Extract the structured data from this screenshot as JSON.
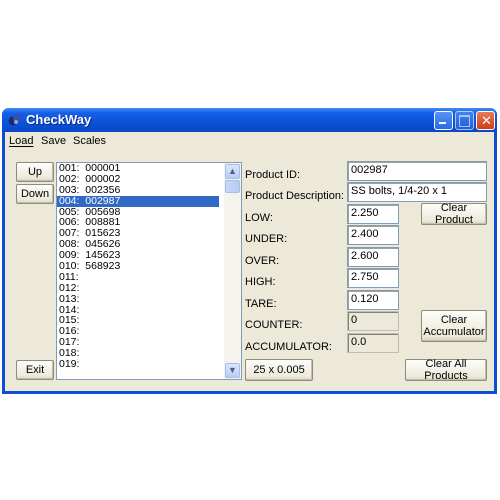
{
  "window": {
    "title": "CheckWay",
    "controls": {
      "minimize": "minimize",
      "maximize": "maximize",
      "close": "close"
    }
  },
  "menu": {
    "items": [
      {
        "label": "Load",
        "accel": "L"
      },
      {
        "label": "Save",
        "accel": "S"
      },
      {
        "label": "Scales",
        "accel": "c"
      }
    ]
  },
  "buttons": {
    "up": "Up",
    "down": "Down",
    "exit": "Exit",
    "clear_product": "Clear Product",
    "clear_accumulator": "Clear Accumulator",
    "clear_all_products": "Clear All Products",
    "scale_info": "25 x 0.005"
  },
  "product_list": {
    "selected_index": 3,
    "items": [
      "001:  000001",
      "002:  000002",
      "003:  002356",
      "004:  002987",
      "005:  005698",
      "006:  008881",
      "007:  015623",
      "008:  045626",
      "009:  145623",
      "010:  568923",
      "011:",
      "012:",
      "013:",
      "014:",
      "015:",
      "016:",
      "017:",
      "018:",
      "019:"
    ]
  },
  "form": {
    "product_id": {
      "label": "Product ID:",
      "value": "002987"
    },
    "product_description": {
      "label": "Product Description:",
      "value": "SS bolts, 1/4-20 x 1"
    },
    "low": {
      "label": "LOW:",
      "value": "2.250"
    },
    "under": {
      "label": "UNDER:",
      "value": "2.400"
    },
    "over": {
      "label": "OVER:",
      "value": "2.600"
    },
    "high": {
      "label": "HIGH:",
      "value": "2.750"
    },
    "tare": {
      "label": "TARE:",
      "value": "0.120"
    },
    "counter": {
      "label": "COUNTER:",
      "value": "0"
    },
    "accumulator": {
      "label": "ACCUMULATOR:",
      "value": "0.0"
    }
  }
}
